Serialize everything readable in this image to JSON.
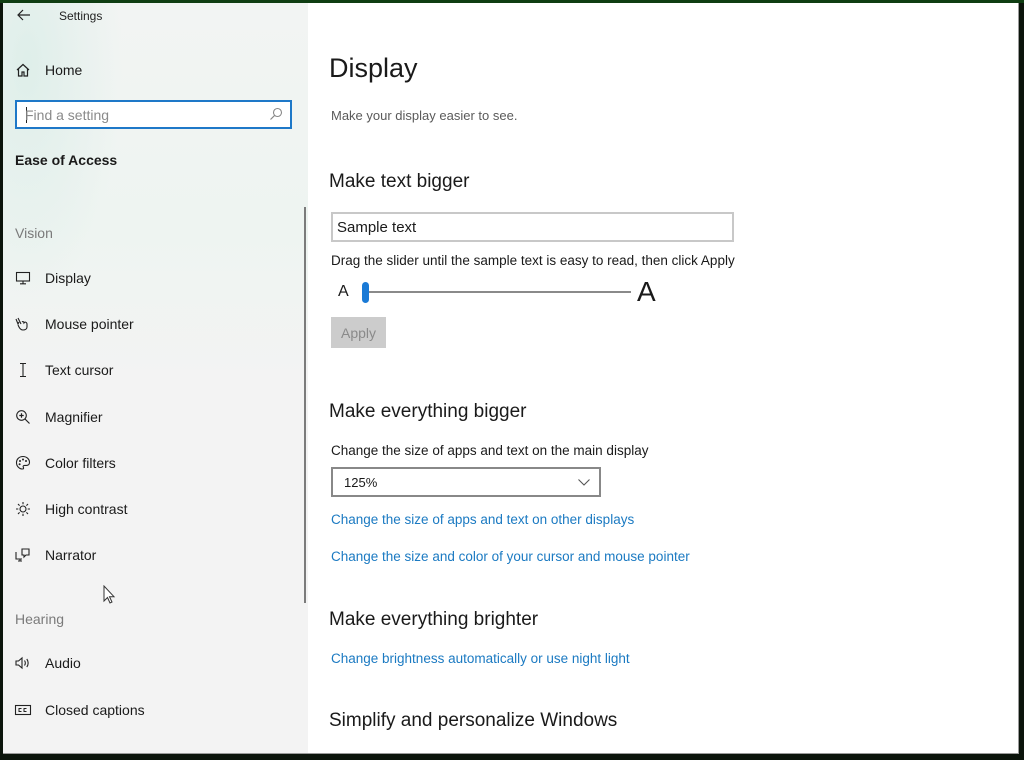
{
  "window": {
    "title": "Settings",
    "back_icon": "back-arrow-icon"
  },
  "sidebar": {
    "home": {
      "label": "Home",
      "icon": "home-icon"
    },
    "search": {
      "placeholder": "Find a setting",
      "value": "",
      "icon": "search-icon"
    },
    "section_title": "Ease of Access",
    "groups": [
      {
        "label": "Vision",
        "items": [
          {
            "label": "Display",
            "icon": "monitor-icon"
          },
          {
            "label": "Mouse pointer",
            "icon": "mouse-pointer-icon"
          },
          {
            "label": "Text cursor",
            "icon": "text-cursor-icon"
          },
          {
            "label": "Magnifier",
            "icon": "magnifier-icon"
          },
          {
            "label": "Color filters",
            "icon": "palette-icon"
          },
          {
            "label": "High contrast",
            "icon": "sun-icon"
          },
          {
            "label": "Narrator",
            "icon": "narrator-icon"
          }
        ]
      },
      {
        "label": "Hearing",
        "items": [
          {
            "label": "Audio",
            "icon": "speaker-icon"
          },
          {
            "label": "Closed captions",
            "icon": "closed-captions-icon"
          }
        ]
      }
    ]
  },
  "main": {
    "title": "Display",
    "description": "Make your display easier to see.",
    "text_bigger": {
      "heading": "Make text bigger",
      "sample_text": "Sample text",
      "instruction": "Drag the slider until the sample text is easy to read, then click Apply",
      "slider_min_label": "A",
      "slider_max_label": "A",
      "slider_value_fraction": 0.0,
      "apply_label": "Apply",
      "apply_enabled": false
    },
    "everything_bigger": {
      "heading": "Make everything bigger",
      "dropdown_label": "Change the size of apps and text on the main display",
      "dropdown_value": "125%",
      "links": [
        "Change the size of apps and text on other displays",
        "Change the size and color of your cursor and mouse pointer"
      ]
    },
    "brighter": {
      "heading": "Make everything brighter",
      "link": "Change brightness automatically or use night light"
    },
    "simplify": {
      "heading": "Simplify and personalize Windows"
    }
  },
  "colors": {
    "accent": "#1a7ad6",
    "link": "#1b7ac2",
    "search_border": "#1e78c8"
  }
}
